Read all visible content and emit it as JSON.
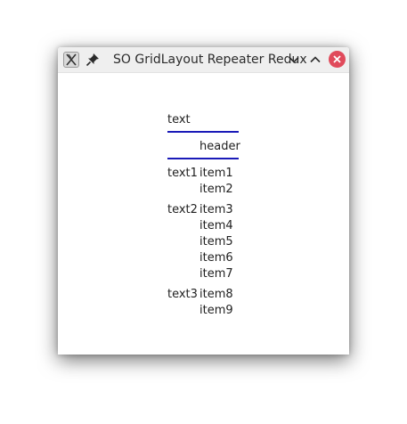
{
  "window": {
    "title": "SO GridLayout Repeater Redux"
  },
  "grid": {
    "top_label": "text",
    "header_label": "header",
    "groups": [
      {
        "label": "text1",
        "items": [
          "item1",
          "item2"
        ]
      },
      {
        "label": "text2",
        "items": [
          "item3",
          "item4",
          "item5",
          "item6",
          "item7"
        ]
      },
      {
        "label": "text3",
        "items": [
          "item8",
          "item9"
        ]
      }
    ]
  },
  "colors": {
    "divider": "#1a1ab8",
    "close_button": "#e04a5b",
    "titlebar": "#efefef"
  }
}
